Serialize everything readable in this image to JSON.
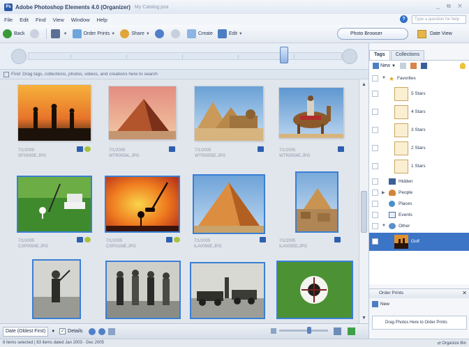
{
  "window": {
    "title": "Adobe Photoshop Elements 4.0 (Organizer)",
    "catalog": "My Catalog.psa",
    "controls": "_ ⧉ ✕"
  },
  "menubar": {
    "items": [
      "File",
      "Edit",
      "Find",
      "View",
      "Window",
      "Help"
    ],
    "help_placeholder": "Type a question for help"
  },
  "toolbar": {
    "back": "Back",
    "order_prints": "Order Prints",
    "share": "Share",
    "create": "Create",
    "edit": "Edit",
    "photo_browser": "Photo Browser",
    "date_view": "Date View"
  },
  "findbar": {
    "text": "Find: Drag tags, collections, photos, videos, and creations here to search"
  },
  "photos": [
    {
      "date": "7/1/2005",
      "file": "SFI0095E.JPG"
    },
    {
      "date": "7/1/2005",
      "file": "WTR0054L.JPG"
    },
    {
      "date": "7/1/2005",
      "file": "WTR0055E.JPG"
    },
    {
      "date": "7/1/2005",
      "file": "WTR0054E.JPG"
    },
    {
      "date": "7/1/2005",
      "file": "CSP0094E.JPG"
    },
    {
      "date": "7/1/2005",
      "file": "CSP0108E.JPG"
    },
    {
      "date": "7/1/2005",
      "file": "ILA0056E.JPG"
    },
    {
      "date": "7/1/2005",
      "file": "ILA0055D.JPG"
    },
    {
      "date": "",
      "file": ""
    },
    {
      "date": "",
      "file": ""
    },
    {
      "date": "",
      "file": ""
    },
    {
      "date": "",
      "file": ""
    }
  ],
  "bottombar": {
    "sort": "Date (Oldest First)",
    "details": "Details"
  },
  "status": {
    "left": "8 items selected  |  83 items dated Jan 2003 - Dec 2005",
    "right": "⇄ Organize Bin"
  },
  "panel": {
    "tabs": [
      "Tags",
      "Collections"
    ],
    "new_label": "New",
    "tags": [
      {
        "label": "Favorites",
        "level": 0,
        "expanded": true
      },
      {
        "label": "5 Stars",
        "level": 1
      },
      {
        "label": "4 Stars",
        "level": 1
      },
      {
        "label": "3 Stars",
        "level": 1
      },
      {
        "label": "2 Stars",
        "level": 1
      },
      {
        "label": "1 Stars",
        "level": 1
      },
      {
        "label": "Hidden",
        "level": 0
      },
      {
        "label": "People",
        "level": 0
      },
      {
        "label": "Places",
        "level": 0
      },
      {
        "label": "Events",
        "level": 0
      },
      {
        "label": "Other",
        "level": 0,
        "expanded": true
      },
      {
        "label": "Golf",
        "level": 1,
        "selected": true
      }
    ],
    "order_prints": {
      "title": "Order Prints",
      "new_label": "New",
      "drop_hint": "Drag Photos Here to Order Prints"
    }
  },
  "colors": {
    "selection_blue": "#3a7fd4",
    "tag_selected": "#3c74c6",
    "panel_bg": "#f4f6f9"
  }
}
